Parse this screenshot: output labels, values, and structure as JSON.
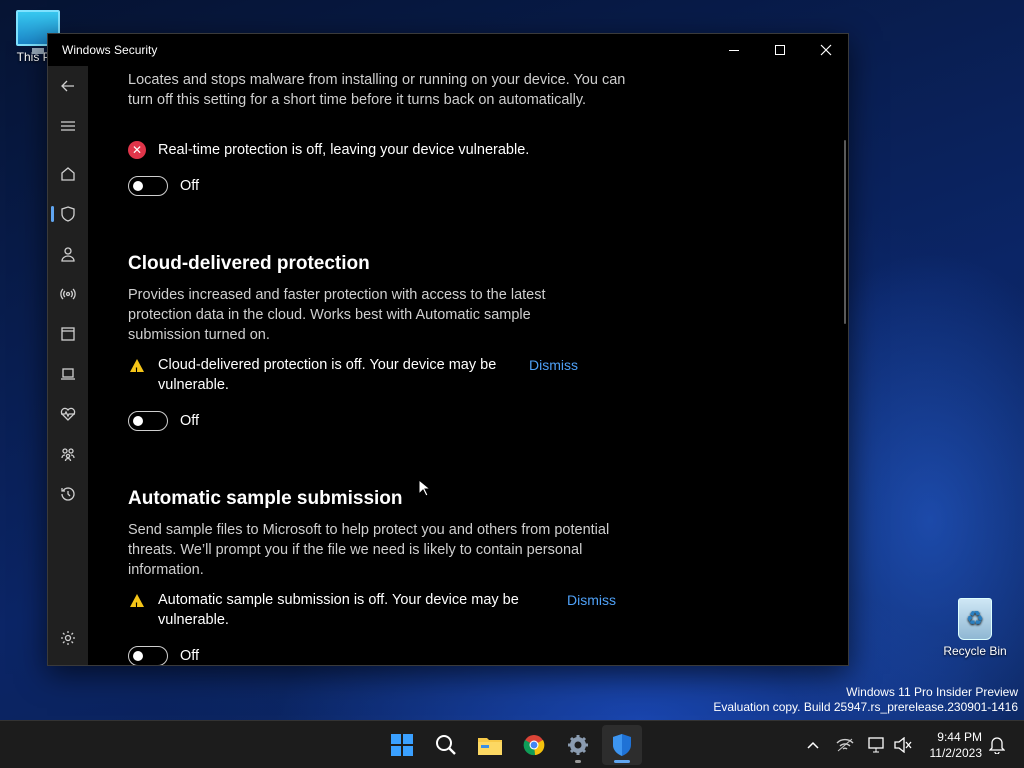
{
  "desktop": {
    "icons": [
      {
        "label": "This PC",
        "icon": "computer-icon"
      },
      {
        "label": "Recycle Bin",
        "icon": "recycle-bin-icon"
      }
    ],
    "watermark": {
      "line1": "Windows 11 Pro Insider Preview",
      "line2": "Evaluation copy. Build 25947.rs_prerelease.230901-1416"
    }
  },
  "window": {
    "title": "Windows Security",
    "controls": {
      "minimize": "minimize-icon",
      "maximize": "maximize-icon",
      "close": "close-icon"
    }
  },
  "nav": {
    "items": [
      {
        "name": "back",
        "icon": "back-arrow-icon"
      },
      {
        "name": "menu",
        "icon": "hamburger-icon"
      },
      {
        "name": "home",
        "icon": "home-icon"
      },
      {
        "name": "virus-threat-protection",
        "icon": "shield-icon",
        "active": true
      },
      {
        "name": "account-protection",
        "icon": "person-icon"
      },
      {
        "name": "firewall-network",
        "icon": "antenna-icon"
      },
      {
        "name": "app-browser-control",
        "icon": "app-window-icon"
      },
      {
        "name": "device-security",
        "icon": "laptop-icon"
      },
      {
        "name": "device-performance",
        "icon": "heart-pulse-icon"
      },
      {
        "name": "family-options",
        "icon": "family-icon"
      },
      {
        "name": "protection-history",
        "icon": "history-icon"
      },
      {
        "name": "settings",
        "icon": "gear-icon"
      }
    ]
  },
  "sections": {
    "realtime": {
      "description": "Locates and stops malware from installing or running on your device. You can turn off this setting for a short time before it turns back on automatically.",
      "status": "Real-time protection is off, leaving your device vulnerable.",
      "toggle_label": "Off"
    },
    "cloud": {
      "heading": "Cloud-delivered protection",
      "description": "Provides increased and faster protection with access to the latest protection data in the cloud. Works best with Automatic sample submission turned on.",
      "status": "Cloud-delivered protection is off. Your device may be vulnerable.",
      "dismiss": "Dismiss",
      "toggle_label": "Off"
    },
    "sample": {
      "heading": "Automatic sample submission",
      "description": "Send sample files to Microsoft to help protect you and others from potential threats. We’ll prompt you if the file we need is likely to contain personal information.",
      "status": "Automatic sample submission is off. Your device may be vulnerable.",
      "dismiss": "Dismiss",
      "toggle_label": "Off"
    }
  },
  "taskbar": {
    "apps": [
      {
        "name": "start",
        "icon": "windows-logo-icon"
      },
      {
        "name": "search",
        "icon": "search-icon"
      },
      {
        "name": "file-explorer",
        "icon": "folder-icon"
      },
      {
        "name": "chrome",
        "icon": "chrome-icon"
      },
      {
        "name": "settings",
        "icon": "gear-icon"
      },
      {
        "name": "windows-security",
        "icon": "shield-icon"
      }
    ],
    "tray": {
      "chevron": "chevron-up-icon",
      "network": "network-icon",
      "display": "display-icon",
      "volume": "volume-muted-icon",
      "notifications": "bell-icon"
    },
    "clock": {
      "time": "9:44 PM",
      "date": "11/2/2023"
    }
  },
  "colors": {
    "accent": "#60a5f0",
    "link": "#4fa1f7",
    "error": "#e0354a",
    "warning": "#f5c518"
  }
}
